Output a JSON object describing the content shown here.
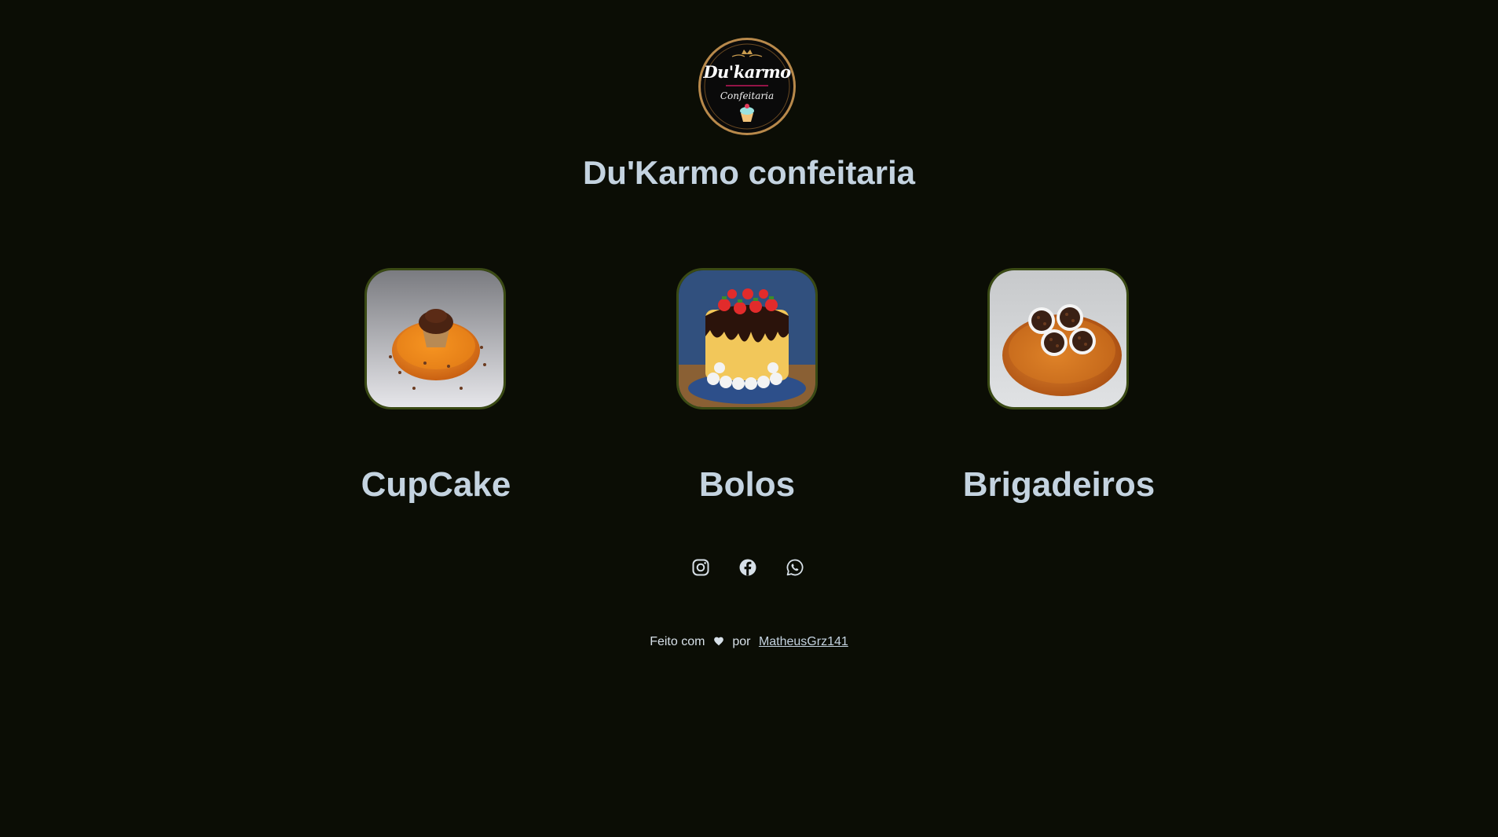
{
  "brand": {
    "logo": {
      "icon": "cupcake-logo",
      "title_text": "Du'karmo",
      "subtitle_text": "Confeitaria",
      "ring_color": "#b8894b"
    },
    "site_title": "Du'Karmo confeitaria"
  },
  "categories": [
    {
      "label": "CupCake",
      "image": "cupcake-photo"
    },
    {
      "label": "Bolos",
      "image": "cake-photo"
    },
    {
      "label": "Brigadeiros",
      "image": "brigadeiros-photo"
    }
  ],
  "social": [
    {
      "name": "instagram",
      "icon": "instagram-icon"
    },
    {
      "name": "facebook",
      "icon": "facebook-icon"
    },
    {
      "name": "whatsapp",
      "icon": "whatsapp-icon"
    }
  ],
  "footer": {
    "made_with": "Feito com",
    "heart_icon": "heart-icon",
    "by": "por",
    "author": "MatheusGrz141"
  },
  "colors": {
    "background": "#0b0d05",
    "text": "#c4d3e0",
    "card_border": "#3a4a14"
  }
}
